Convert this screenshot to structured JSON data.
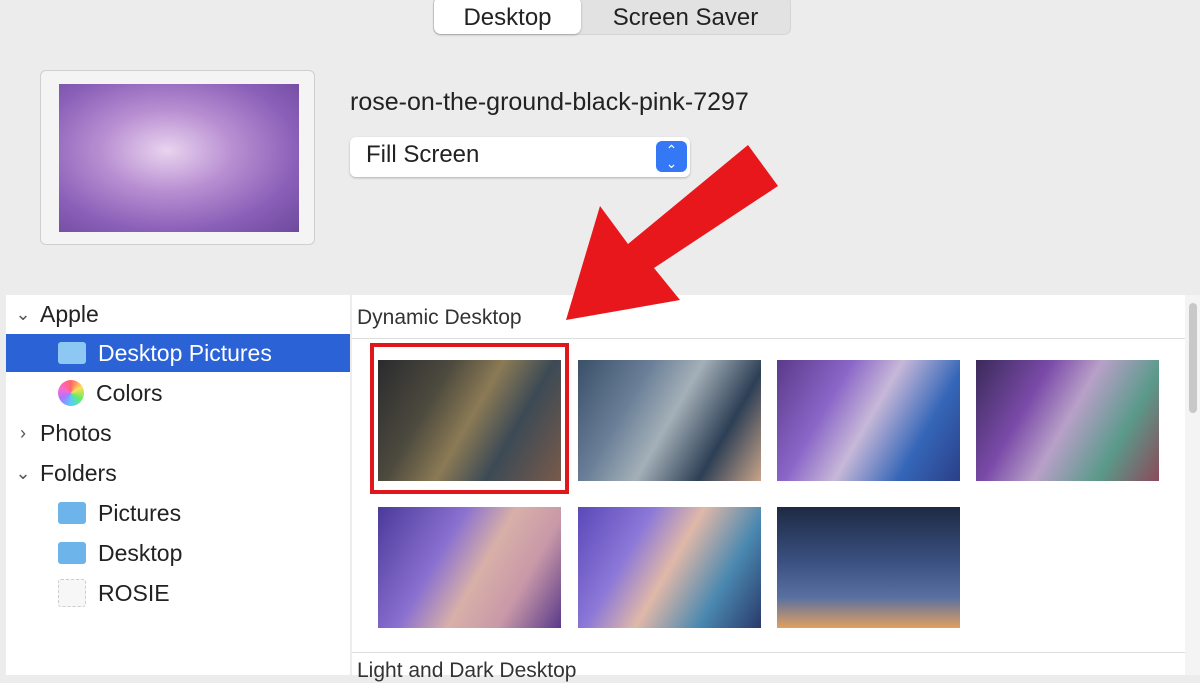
{
  "tabs": [
    {
      "label": "Desktop",
      "active": true
    },
    {
      "label": "Screen Saver",
      "active": false
    }
  ],
  "wallpaper": {
    "name": "rose-on-the-ground-black-pink-7297",
    "fit": "Fill Screen"
  },
  "sidebar": {
    "groups": [
      {
        "label": "Apple",
        "expanded": true,
        "items": [
          {
            "label": "Desktop Pictures",
            "icon": "folder-icon",
            "selected": true
          },
          {
            "label": "Colors",
            "icon": "color-wheel-icon"
          }
        ]
      },
      {
        "label": "Photos",
        "expanded": false
      },
      {
        "label": "Folders",
        "expanded": true,
        "items": [
          {
            "label": "Pictures",
            "icon": "pictures-folder-icon"
          },
          {
            "label": "Desktop",
            "icon": "folder-icon"
          },
          {
            "label": "ROSIE",
            "icon": "blank-icon"
          }
        ]
      }
    ]
  },
  "sections": [
    {
      "title": "Dynamic Desktop",
      "thumbnails": 7,
      "selected": 0
    },
    {
      "title": "Light and Dark Desktop"
    }
  ],
  "colors": {
    "accent": "#2b62d6",
    "annotation": "#e0161b"
  }
}
